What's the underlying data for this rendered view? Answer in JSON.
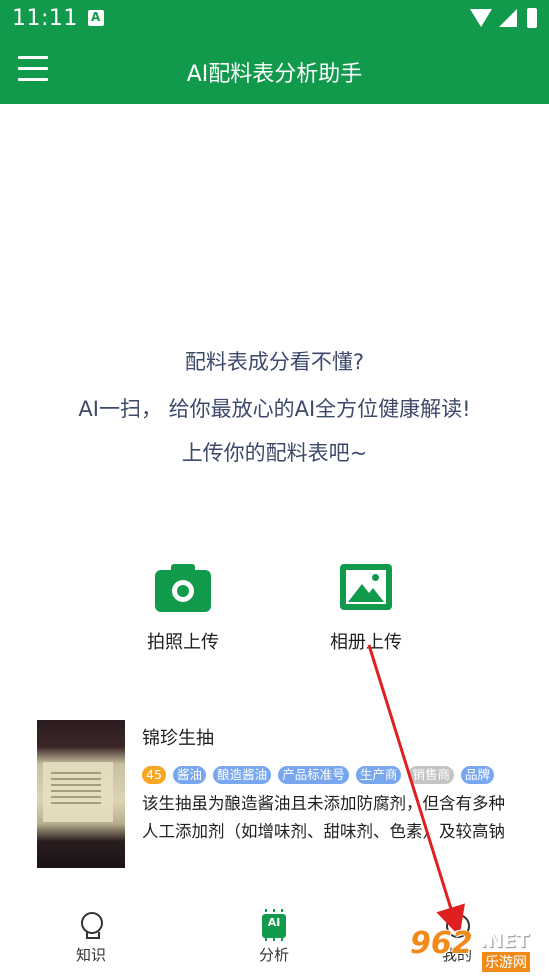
{
  "status_bar": {
    "time": "11:11",
    "notification_icon": "app-notification-icon",
    "icons": [
      "wifi-icon",
      "signal-icon",
      "battery-icon"
    ]
  },
  "app_bar": {
    "title": "AI配料表分析助手",
    "menu_icon": "hamburger-menu-icon",
    "background_color": "#11994c"
  },
  "intro": {
    "line1": "配料表成分看不懂?",
    "line2": "AI一扫， 给你最放心的AI全方位健康解读!",
    "line3": "上传你的配料表吧~",
    "text_color": "#3d4a6b"
  },
  "upload": {
    "camera": {
      "label": "拍照上传",
      "icon": "camera-icon"
    },
    "gallery": {
      "label": "相册上传",
      "icon": "image-gallery-icon"
    }
  },
  "product": {
    "name": "锦珍生抽",
    "score": "45",
    "tags": [
      "酱油",
      "酿造酱油",
      "产品标准号",
      "生产商",
      "销售商",
      "品牌"
    ],
    "description_line1": "该生抽虽为酿造酱油且未添加防腐剂，但含有多种",
    "description_line2": "人工添加剂（如增味剂、甜味剂、色素）及较高钠"
  },
  "bottom_nav": {
    "items": [
      {
        "label": "知识",
        "icon": "lightbulb-icon"
      },
      {
        "label": "分析",
        "icon": "ai-chip-icon",
        "chip_text": "AI",
        "active": true
      },
      {
        "label": "我的",
        "icon": "user-smile-icon"
      }
    ]
  },
  "annotation": {
    "arrow_color": "#e02020"
  },
  "watermark": {
    "logo": "962",
    "net": ".NET",
    "site": "乐游网"
  }
}
